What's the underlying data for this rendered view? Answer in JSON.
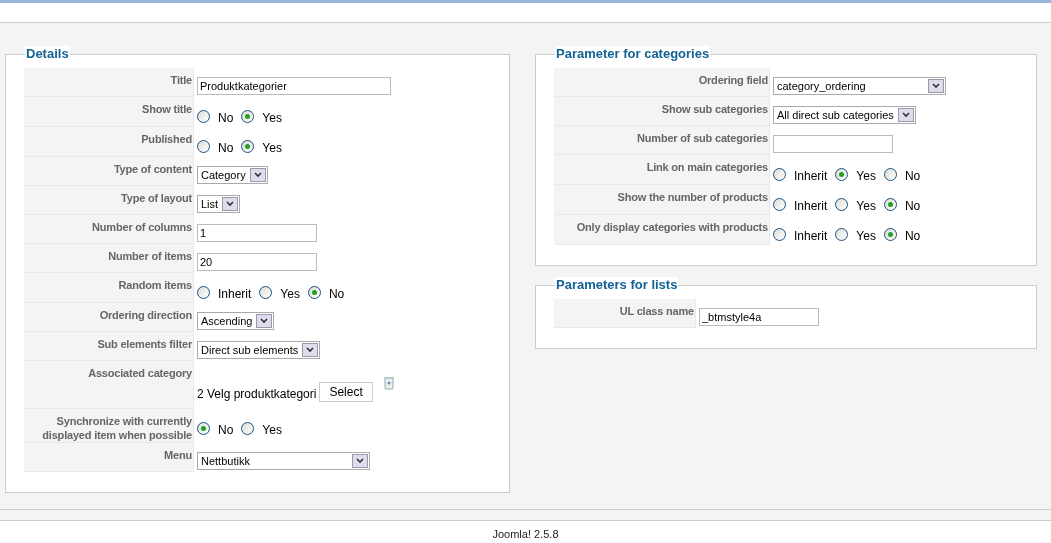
{
  "details": {
    "legend": "Details",
    "fields": [
      {
        "kind": "longtext",
        "label": "Title",
        "value": "Produktkategorier"
      },
      {
        "kind": "radio",
        "label": "Show title",
        "options": [
          {
            "label": "No",
            "selected": false
          },
          {
            "label": "Yes",
            "selected": true
          }
        ]
      },
      {
        "kind": "radio",
        "label": "Published",
        "options": [
          {
            "label": "No",
            "selected": false
          },
          {
            "label": "Yes",
            "selected": true
          }
        ]
      },
      {
        "kind": "select",
        "label": "Type of content",
        "value": "Category"
      },
      {
        "kind": "select",
        "label": "Type of layout",
        "value": "List"
      },
      {
        "kind": "text",
        "label": "Number of columns",
        "value": "1"
      },
      {
        "kind": "text",
        "label": "Number of items",
        "value": "20"
      },
      {
        "kind": "radio",
        "label": "Random items",
        "options": [
          {
            "label": "Inherit",
            "selected": false
          },
          {
            "label": "Yes",
            "selected": false
          },
          {
            "label": "No",
            "selected": true
          }
        ]
      },
      {
        "kind": "select",
        "label": "Ordering direction",
        "value": "Ascending"
      },
      {
        "kind": "select",
        "label": "Sub elements filter",
        "value": "Direct sub elements"
      },
      {
        "kind": "category",
        "label": "Associated category",
        "value": "2 Velg produktkategori",
        "button": "Select"
      },
      {
        "kind": "radio",
        "label": "Synchronize with currently displayed item when possible",
        "options": [
          {
            "label": "No",
            "selected": true
          },
          {
            "label": "Yes",
            "selected": false
          }
        ]
      },
      {
        "kind": "longselect",
        "label": "Menu",
        "value": "Nettbutikk"
      }
    ]
  },
  "categories": {
    "legend": "Parameter for categories",
    "fields": [
      {
        "kind": "longselect",
        "label": "Ordering field",
        "value": "category_ordering"
      },
      {
        "kind": "select",
        "label": "Show sub categories",
        "value": "All direct sub categories"
      },
      {
        "kind": "text",
        "label": "Number of sub categories"
      },
      {
        "kind": "radio",
        "label": "Link on main categories",
        "options": [
          {
            "label": "Inherit",
            "selected": false
          },
          {
            "label": "Yes",
            "selected": true
          },
          {
            "label": "No",
            "selected": false
          }
        ]
      },
      {
        "kind": "radio",
        "label": "Show the number of products",
        "options": [
          {
            "label": "Inherit",
            "selected": false
          },
          {
            "label": "Yes",
            "selected": false
          },
          {
            "label": "No",
            "selected": true
          }
        ]
      },
      {
        "kind": "radio",
        "label": "Only display categories with products",
        "options": [
          {
            "label": "Inherit",
            "selected": false
          },
          {
            "label": "Yes",
            "selected": false
          },
          {
            "label": "No",
            "selected": true
          }
        ]
      }
    ]
  },
  "lists": {
    "legend": "Parameters for lists",
    "fields": [
      {
        "kind": "text",
        "label": "UL class name",
        "value": "_btmstyle4a"
      }
    ]
  },
  "footer": "Joomla! 2.5.8"
}
